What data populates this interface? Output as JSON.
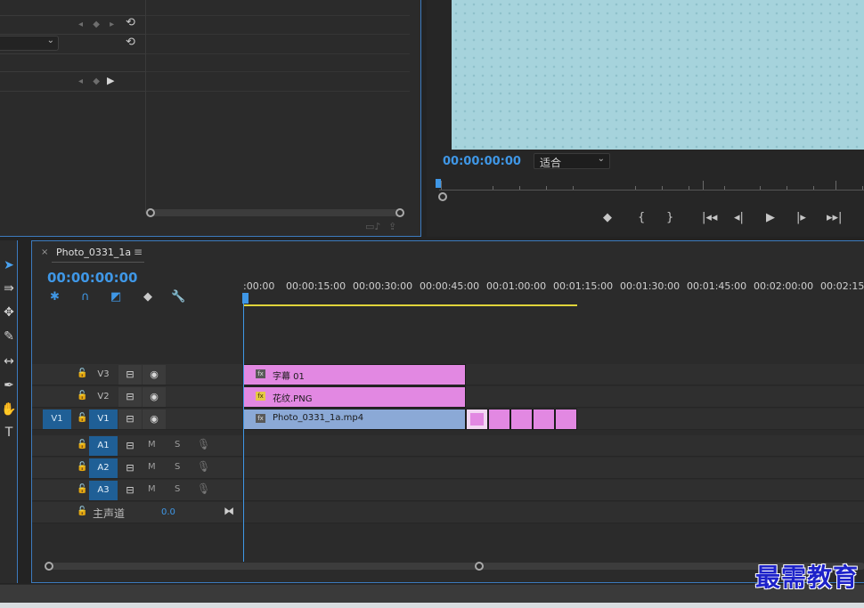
{
  "effect_controls": {
    "keyframe_nav": "◂ ◆ ▸",
    "reset_icon": "⟲",
    "dropdown_chevron": "⌄",
    "footer_icons": [
      "▭♪",
      "⇪"
    ]
  },
  "program_monitor": {
    "timecode": "00:00:00:00",
    "fit": "适合",
    "transport": [
      "◆",
      "{",
      "}",
      "|◂◂",
      "◂|",
      "▶",
      "|▸",
      "▸▸|",
      "⇥"
    ]
  },
  "timeline": {
    "sequence_name": "Photo_0331_1a",
    "close": "×",
    "menu": "≡",
    "timecode": "00:00:00:00",
    "ruler_labels": [
      ":00:00",
      "00:00:15:00",
      "00:00:30:00",
      "00:00:45:00",
      "00:01:00:00",
      "00:01:15:00",
      "00:01:30:00",
      "00:01:45:00",
      "00:02:00:00",
      "00:02:15:00"
    ],
    "video_tracks": [
      {
        "name": "V3",
        "source": ""
      },
      {
        "name": "V2",
        "source": ""
      },
      {
        "name": "V1",
        "source": "V1"
      }
    ],
    "audio_tracks": [
      {
        "name": "A1",
        "m": "M",
        "s": "S"
      },
      {
        "name": "A2",
        "m": "M",
        "s": "S"
      },
      {
        "name": "A3",
        "m": "M",
        "s": "S"
      }
    ],
    "master": {
      "label": "主声道",
      "value": "0.0"
    },
    "clips": {
      "v3": "字幕 01",
      "v2": "花纹.PNG",
      "v1": "Photo_0331_1a.mp4"
    }
  },
  "watermark": "最需教育",
  "colors": {
    "accent": "#3f97e6",
    "clip_pink": "#e288e2",
    "clip_blue": "#8ba9d6",
    "work_area": "#e0d43a"
  }
}
